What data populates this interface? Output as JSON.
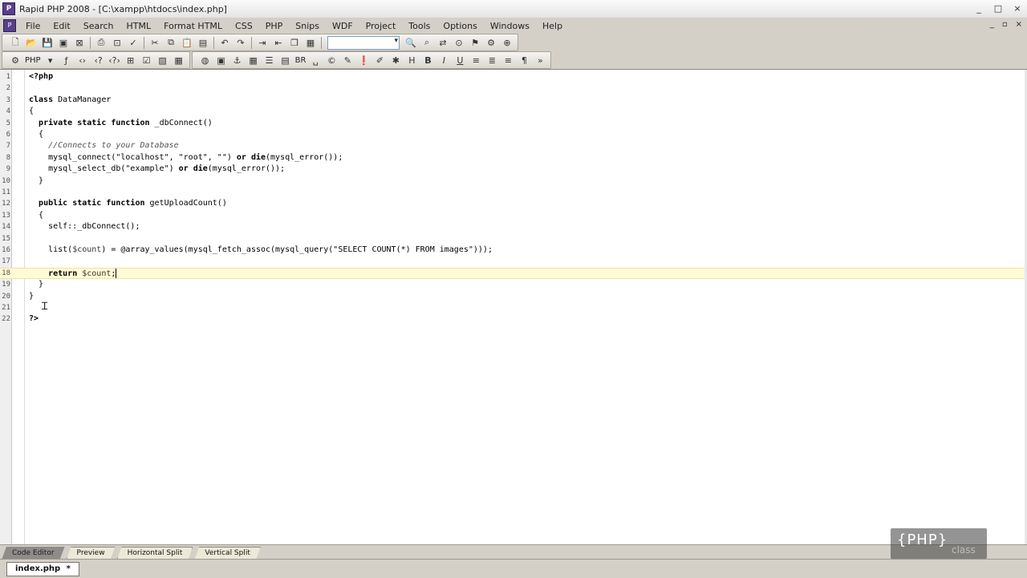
{
  "window": {
    "title": "Rapid PHP 2008 - [C:\\xampp\\htdocs\\index.php]",
    "app_icon": "rapid-php-icon",
    "controls": [
      "_",
      "□",
      "×"
    ]
  },
  "menu": {
    "items": [
      "File",
      "Edit",
      "Search",
      "HTML",
      "Format HTML",
      "CSS",
      "PHP",
      "Snips",
      "WDF",
      "Project",
      "Tools",
      "Options",
      "Windows",
      "Help"
    ],
    "mdi_controls": [
      "_",
      "▫",
      "×"
    ]
  },
  "toolbar2": {
    "php_label": "PHP",
    "br_label": "BR"
  },
  "editor": {
    "current_line": 18,
    "lines": [
      {
        "n": "1",
        "html": "<span class=\"kw\">&lt;?php</span>"
      },
      {
        "n": "2",
        "html": ""
      },
      {
        "n": "3",
        "html": "<span class=\"kw\">class</span> DataManager"
      },
      {
        "n": "4",
        "html": "{"
      },
      {
        "n": "5",
        "html": "  <span class=\"kw\">private static function</span> _dbConnect()"
      },
      {
        "n": "6",
        "html": "  {"
      },
      {
        "n": "7",
        "html": "    <span class=\"cm\">//Connects to your Database</span>"
      },
      {
        "n": "8",
        "html": "    mysql_connect(\"localhost\", \"root\", \"\") <span class=\"kw\">or die</span>(mysql_error());"
      },
      {
        "n": "9",
        "html": "    mysql_select_db(\"example\") <span class=\"kw\">or die</span>(mysql_error());"
      },
      {
        "n": "10",
        "html": "  }"
      },
      {
        "n": "11",
        "html": ""
      },
      {
        "n": "12",
        "html": "  <span class=\"kw\">public static function</span> getUploadCount()"
      },
      {
        "n": "13",
        "html": "  {"
      },
      {
        "n": "14",
        "html": "    self::_dbConnect();"
      },
      {
        "n": "15",
        "html": ""
      },
      {
        "n": "16",
        "html": "    list(<span class=\"var\">$count</span>) = @array_values(mysql_fetch_assoc(mysql_query(\"SELECT COUNT(*) FROM images\")));"
      },
      {
        "n": "17",
        "html": ""
      },
      {
        "n": "18",
        "html": "    <span class=\"kw\">return</span> <span class=\"var\">$count</span>;<span class=\"caret\"></span>"
      },
      {
        "n": "19",
        "html": "  }"
      },
      {
        "n": "20",
        "html": "}"
      },
      {
        "n": "21",
        "html": ""
      },
      {
        "n": "22",
        "html": "<span class=\"kw\">?&gt;</span>"
      }
    ]
  },
  "view_tabs": [
    "Code Editor",
    "Preview",
    "Horizontal Split",
    "Vertical Split"
  ],
  "active_view_tab": "Code Editor",
  "document_tabs": [
    {
      "label": "index.php",
      "modified_marker": "*"
    }
  ],
  "watermark": {
    "main": "{PHP}",
    "sub": "class"
  }
}
